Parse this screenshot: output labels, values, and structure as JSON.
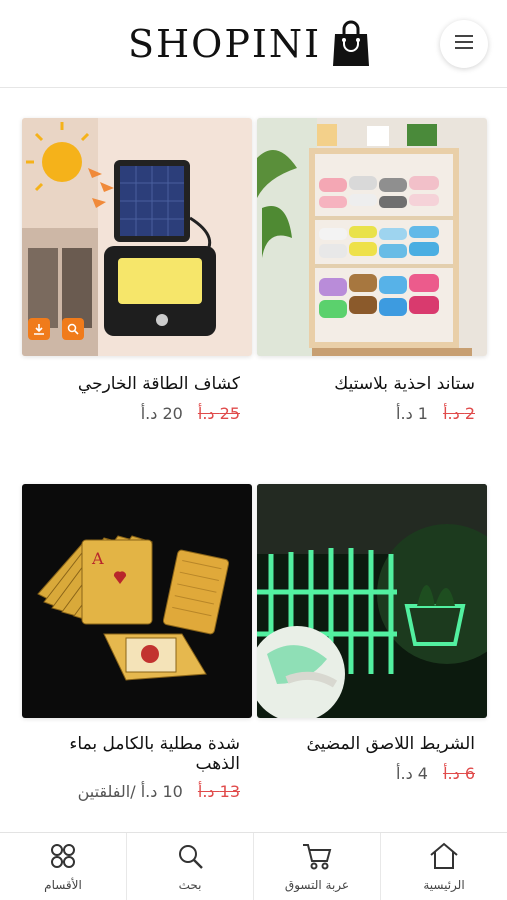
{
  "header": {
    "brand": "SHOPINI",
    "logo_icon": "shopping-bag-icon",
    "menu_icon": "hamburger-menu-icon"
  },
  "products": [
    {
      "title": "ستاند احذية بلاستيك",
      "old_price": "2 د.أ",
      "new_price": "1 د.أ",
      "image": "shoe-rack-photo"
    },
    {
      "title": "كشاف الطاقة الخارجي",
      "old_price": "25 د.أ",
      "new_price": "20 د.أ",
      "image": "solar-light-photo",
      "badges": [
        "download-icon",
        "zoom-icon"
      ]
    },
    {
      "title": "الشريط اللاصق المضيئ",
      "old_price": "6 د.أ",
      "new_price": "4 د.أ",
      "image": "glowing-tape-photo"
    },
    {
      "title": "شدة مطلية بالكامل بماء الذهب",
      "old_price": "13 د.أ",
      "new_price": "10 د.أ /الفلقتين",
      "image": "gold-cards-photo"
    }
  ],
  "bottom_nav": [
    {
      "label": "الرئيسية",
      "icon": "home-icon"
    },
    {
      "label": "عربة التسوق",
      "icon": "cart-icon"
    },
    {
      "label": "بحث",
      "icon": "search-icon"
    },
    {
      "label": "الأقسام",
      "icon": "categories-icon"
    }
  ],
  "colors": {
    "price_old": "#e04b4b",
    "badge": "#f07b1b",
    "text": "#111111"
  }
}
